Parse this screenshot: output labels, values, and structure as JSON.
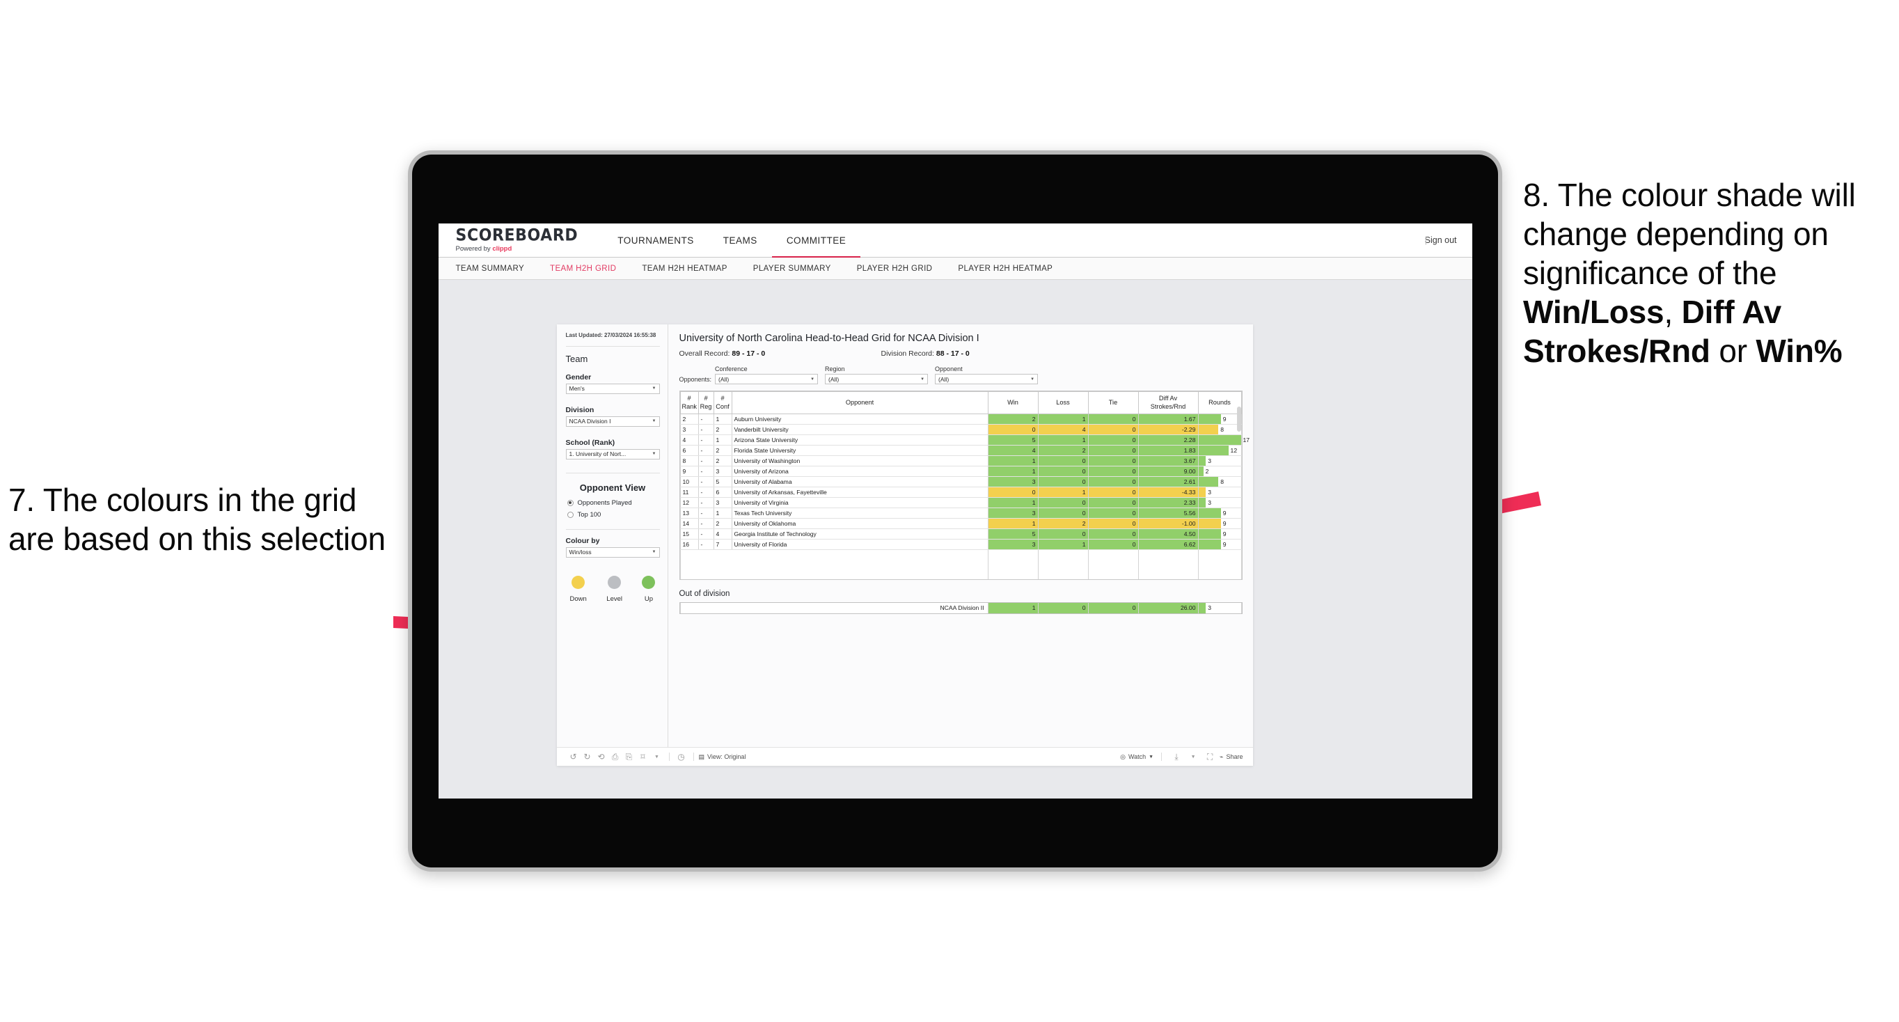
{
  "annotations": {
    "left": {
      "id": "7",
      "text": "7. The colours in the grid are based on this selection"
    },
    "right": {
      "id": "8",
      "pre": "8. The colour shade will change depending on significance of the ",
      "bold1": "Win/Loss",
      "mid1": ", ",
      "bold2": "Diff Av Strokes/Rnd",
      "mid2": " or ",
      "bold3": "Win%"
    },
    "arrow_color": "#ef2d56"
  },
  "app": {
    "brand": {
      "name": "SCOREBOARD",
      "powered_prefix": "Powered by ",
      "powered_brand": "clippd"
    },
    "top_nav": [
      {
        "label": "TOURNAMENTS",
        "active": false
      },
      {
        "label": "TEAMS",
        "active": false
      },
      {
        "label": "COMMITTEE",
        "active": true
      }
    ],
    "sign_out": "Sign out",
    "sub_nav": [
      {
        "label": "TEAM SUMMARY",
        "active": false
      },
      {
        "label": "TEAM H2H GRID",
        "active": true
      },
      {
        "label": "TEAM H2H HEATMAP",
        "active": false
      },
      {
        "label": "PLAYER SUMMARY",
        "active": false
      },
      {
        "label": "PLAYER H2H GRID",
        "active": false
      },
      {
        "label": "PLAYER H2H HEATMAP",
        "active": false
      }
    ],
    "accent": "#d8234a"
  },
  "sidebar": {
    "last_updated": "Last Updated: 27/03/2024 16:55:38",
    "team_heading": "Team",
    "filters": [
      {
        "label": "Gender",
        "value": "Men's"
      },
      {
        "label": "Division",
        "value": "NCAA Division I"
      },
      {
        "label": "School (Rank)",
        "value": "1. University of Nort..."
      }
    ],
    "opponent_view": {
      "heading": "Opponent View",
      "options": [
        {
          "label": "Opponents Played",
          "selected": true
        },
        {
          "label": "Top 100",
          "selected": false
        }
      ]
    },
    "colour_by": {
      "label": "Colour by",
      "value": "Win/loss"
    },
    "legend": [
      {
        "label": "Down",
        "color": "#f3d04e"
      },
      {
        "label": "Level",
        "color": "#bcbec2"
      },
      {
        "label": "Up",
        "color": "#7ec15c"
      }
    ]
  },
  "view": {
    "title": "University of North Carolina Head-to-Head Grid for NCAA Division I",
    "overall_record_label": "Overall Record: ",
    "overall_record": "89 - 17 - 0",
    "division_record_label": "Division Record: ",
    "division_record": "88 - 17 - 0",
    "opponents_label": "Opponents:",
    "opponent_filters": [
      {
        "label": "Conference",
        "value": "(All)"
      },
      {
        "label": "Region",
        "value": "(All)"
      },
      {
        "label": "Opponent",
        "value": "(All)"
      }
    ]
  },
  "chart_data": {
    "type": "table",
    "title": "University of North Carolina Head-to-Head Grid for NCAA Division I",
    "columns": [
      "# Rank",
      "# Reg",
      "# Conf",
      "Opponent",
      "Win",
      "Loss",
      "Tie",
      "Diff Av Strokes/Rnd",
      "Rounds"
    ],
    "colour_scheme": {
      "up": "#91cf6a",
      "down": "#f3d04e",
      "level": "#bcbec2"
    },
    "rounds_max": 17,
    "rows": [
      {
        "rank": "2",
        "reg": "-",
        "conf": "1",
        "opponent": "Auburn University",
        "win": "2",
        "loss": "1",
        "tie": "0",
        "diff": "1.67",
        "rounds": "9",
        "state": "up"
      },
      {
        "rank": "3",
        "reg": "-",
        "conf": "2",
        "opponent": "Vanderbilt University",
        "win": "0",
        "loss": "4",
        "tie": "0",
        "diff": "-2.29",
        "rounds": "8",
        "state": "down"
      },
      {
        "rank": "4",
        "reg": "-",
        "conf": "1",
        "opponent": "Arizona State University",
        "win": "5",
        "loss": "1",
        "tie": "0",
        "diff": "2.28",
        "rounds": "17",
        "state": "up"
      },
      {
        "rank": "6",
        "reg": "-",
        "conf": "2",
        "opponent": "Florida State University",
        "win": "4",
        "loss": "2",
        "tie": "0",
        "diff": "1.83",
        "rounds": "12",
        "state": "up"
      },
      {
        "rank": "8",
        "reg": "-",
        "conf": "2",
        "opponent": "University of Washington",
        "win": "1",
        "loss": "0",
        "tie": "0",
        "diff": "3.67",
        "rounds": "3",
        "state": "up"
      },
      {
        "rank": "9",
        "reg": "-",
        "conf": "3",
        "opponent": "University of Arizona",
        "win": "1",
        "loss": "0",
        "tie": "0",
        "diff": "9.00",
        "rounds": "2",
        "state": "up"
      },
      {
        "rank": "10",
        "reg": "-",
        "conf": "5",
        "opponent": "University of Alabama",
        "win": "3",
        "loss": "0",
        "tie": "0",
        "diff": "2.61",
        "rounds": "8",
        "state": "up"
      },
      {
        "rank": "11",
        "reg": "-",
        "conf": "6",
        "opponent": "University of Arkansas, Fayetteville",
        "win": "0",
        "loss": "1",
        "tie": "0",
        "diff": "-4.33",
        "rounds": "3",
        "state": "down"
      },
      {
        "rank": "12",
        "reg": "-",
        "conf": "3",
        "opponent": "University of Virginia",
        "win": "1",
        "loss": "0",
        "tie": "0",
        "diff": "2.33",
        "rounds": "3",
        "state": "up"
      },
      {
        "rank": "13",
        "reg": "-",
        "conf": "1",
        "opponent": "Texas Tech University",
        "win": "3",
        "loss": "0",
        "tie": "0",
        "diff": "5.56",
        "rounds": "9",
        "state": "up"
      },
      {
        "rank": "14",
        "reg": "-",
        "conf": "2",
        "opponent": "University of Oklahoma",
        "win": "1",
        "loss": "2",
        "tie": "0",
        "diff": "-1.00",
        "rounds": "9",
        "state": "down"
      },
      {
        "rank": "15",
        "reg": "-",
        "conf": "4",
        "opponent": "Georgia Institute of Technology",
        "win": "5",
        "loss": "0",
        "tie": "0",
        "diff": "4.50",
        "rounds": "9",
        "state": "up"
      },
      {
        "rank": "16",
        "reg": "-",
        "conf": "7",
        "opponent": "University of Florida",
        "win": "3",
        "loss": "1",
        "tie": "0",
        "diff": "6.62",
        "rounds": "9",
        "state": "up"
      }
    ],
    "out_of_division": {
      "heading": "Out of division",
      "row": {
        "opponent": "NCAA Division II",
        "win": "1",
        "loss": "0",
        "tie": "0",
        "diff": "26.00",
        "rounds": "3",
        "state": "up"
      }
    }
  },
  "toolbar": {
    "view_label": "View: Original",
    "watch_label": "Watch",
    "share_label": "Share"
  }
}
